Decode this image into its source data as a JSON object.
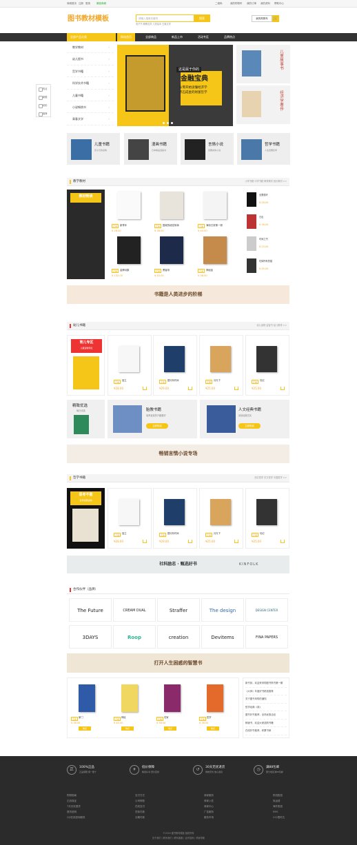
{
  "topbar": {
    "left": [
      "商城首页",
      "注册",
      "登录",
      "微信商城"
    ],
    "right": [
      "二维码",
      "我的购物车",
      "我的订单",
      "我的资料",
      "帮助中心"
    ]
  },
  "logo": "图书教材模板",
  "search": {
    "placeholder": "请输入搜索关键词",
    "button": "搜索",
    "hot": "电子书  聊斋志异  儿童绘本  古典文学"
  },
  "cart": {
    "label": "我的购物车",
    "icon": "cart-icon"
  },
  "nav": {
    "category": "全部产品分类",
    "items": [
      "网站首页",
      "全部商品",
      "新品上市",
      "活动专区",
      "品牌热点"
    ]
  },
  "sidebar": [
    "教学教材",
    "幼儿图书",
    "哲学书籍",
    "科学技术书籍",
    "儿童书籍",
    "小说畅销书",
    "青春文学"
  ],
  "banner": {
    "tag": "这是属于你的",
    "title": "金融宝典",
    "line1": "从零开始读懂经济学",
    "line2": "点石成金的财富哲学"
  },
  "side_ads": [
    {
      "text": "儿童故事书"
    },
    {
      "text": "经济学著作"
    }
  ],
  "float": [
    "热点",
    "新推",
    "精彩",
    "推荐"
  ],
  "categories": [
    {
      "title": "儿童书籍",
      "desc": "孩子们的读物"
    },
    {
      "title": "漫画书籍",
      "desc": "日本精品漫画书"
    },
    {
      "title": "言情小说",
      "desc": "经典言情小说"
    },
    {
      "title": "哲学书籍",
      "desc": "人生经典哲学"
    }
  ],
  "teach": {
    "title": "教学教材",
    "more": "小学书籍  中学书籍  教育教材  音乐教材 >>",
    "promo": "教材畅读",
    "products": [
      {
        "tag": "正品",
        "name": "新青年",
        "price": "¥ 28.00"
      },
      {
        "tag": "正品",
        "name": "围城的秘密故事",
        "price": "¥ 38.00"
      },
      {
        "tag": "正品",
        "name": "海街日常第一辑",
        "price": "¥ 45.00"
      },
      {
        "tag": "正品",
        "name": "金牌诗集",
        "price": "¥ 132.00"
      },
      {
        "tag": "正品",
        "name": "黑客帝",
        "price": "¥ 40.00"
      },
      {
        "tag": "正品",
        "name": "神经症",
        "price": "¥ 38.00"
      }
    ],
    "side": [
      {
        "name": "无限循环",
        "price": "¥ 28.00"
      },
      {
        "name": "日出",
        "price": "¥ 38.00"
      },
      {
        "name": "时间之书",
        "price": "¥ 23.00"
      },
      {
        "name": "吃掉所有的猫",
        "price": "¥ 45.00"
      }
    ]
  },
  "slogan1": "书籍是人类进步的阶梯",
  "kids": {
    "title": "幼儿书籍",
    "more": "幼儿读物  益智书  幼儿教育 >>",
    "promo": "育儿专区",
    "promo_sub": "儿童读物专区",
    "products": [
      {
        "tag": "正品",
        "name": "独立",
        "price": "¥28.00"
      },
      {
        "tag": "正品",
        "name": "银河系时间",
        "price": "¥29.00"
      },
      {
        "tag": "正品",
        "name": "月光下",
        "price": "¥25.00"
      },
      {
        "tag": "正品",
        "name": "世纪",
        "price": "¥25.00"
      }
    ]
  },
  "feature": {
    "left": {
      "title": "精致优选",
      "desc": "每日优选"
    },
    "mid": {
      "title": "胎教书籍",
      "desc": "培养宝宝的兴趣爱好",
      "btn": "立即购买"
    },
    "right": {
      "title": "人文经典书籍",
      "desc": "阅读经典文化",
      "btn": "立即购买"
    }
  },
  "slogan2": "畅销言情小说专场",
  "philo": {
    "title": "哲学书籍",
    "more": "西方哲学  东方哲学  中国哲学 >>",
    "promo": "思考不能",
    "promo_sub": "哲学经典读物",
    "products": [
      {
        "tag": "正品",
        "name": "独立",
        "price": "¥28.00"
      },
      {
        "tag": "正品",
        "name": "银河系时间",
        "price": "¥29.00"
      },
      {
        "tag": "正品",
        "name": "月光下",
        "price": "¥25.00"
      },
      {
        "tag": "正品",
        "name": "世纪",
        "price": "¥25.00"
      }
    ]
  },
  "slogan3": "社科励志 · 甄选好书",
  "slogan3b": "KINFOLK",
  "partners": {
    "title": "合作伙伴（品牌）",
    "brands": [
      "The Future",
      "CREAM DUAL",
      "Straffer",
      "The design",
      "DESIGN CENTER",
      "3DAYS",
      "Roop",
      "creation",
      "Devitems",
      "FINA PAPERS"
    ]
  },
  "slogan4": "打开人生困惑的智慧书",
  "last": {
    "products": [
      {
        "tag": "正品",
        "name": "家门",
        "price": "¥ 38.00",
        "btn": "购买"
      },
      {
        "tag": "正品",
        "name": "神经",
        "price": "¥ 40.00",
        "btn": "购买"
      },
      {
        "tag": "正品",
        "name": "宅家",
        "price": "¥ 38.00",
        "btn": "购买"
      },
      {
        "tag": "正品",
        "name": "哲学",
        "price": "¥ 38.00",
        "btn": "购买"
      }
    ],
    "news": [
      "新书到，欢迎来采购图书购书第一期",
      "《大师》年度好书精选推荐",
      "关于图书采购的通知",
      "哲学经典《泉》",
      "图书好书推荐，全场优惠活动",
      "畅销书，欢迎大家选购书籍",
      "在线好书推荐，积累书单"
    ]
  },
  "footer": {
    "services": [
      {
        "title": "100%正品",
        "desc": "正品保障 假一赔十"
      },
      {
        "title": "低价保障",
        "desc": "精选好书 低价直供"
      },
      {
        "title": "30天无忧退货",
        "desc": "购物无忧 放心退货"
      },
      {
        "title": "满88包邮",
        "desc": "部分地区满88包邮"
      }
    ],
    "cols": [
      [
        "购物指南",
        "正品保证",
        "7天无忧退货",
        "退货说明",
        "QQ在线咨询服务"
      ],
      [
        "支付方式",
        "公司转账",
        "在线支付",
        "货到付款",
        "分期付款"
      ],
      [
        "商家服务",
        "商家入驻",
        "商家中心",
        "广告服务",
        "服务市场"
      ],
      [
        "物流配送",
        "免运费",
        "海外配送",
        "EMS",
        "211限时达"
      ]
    ],
    "copy1": "©2016 图书教材模板 版权所有",
    "copy2": "关于我们 | 联系我们 | 联系客服 | 合作招商 | 商家帮助"
  }
}
